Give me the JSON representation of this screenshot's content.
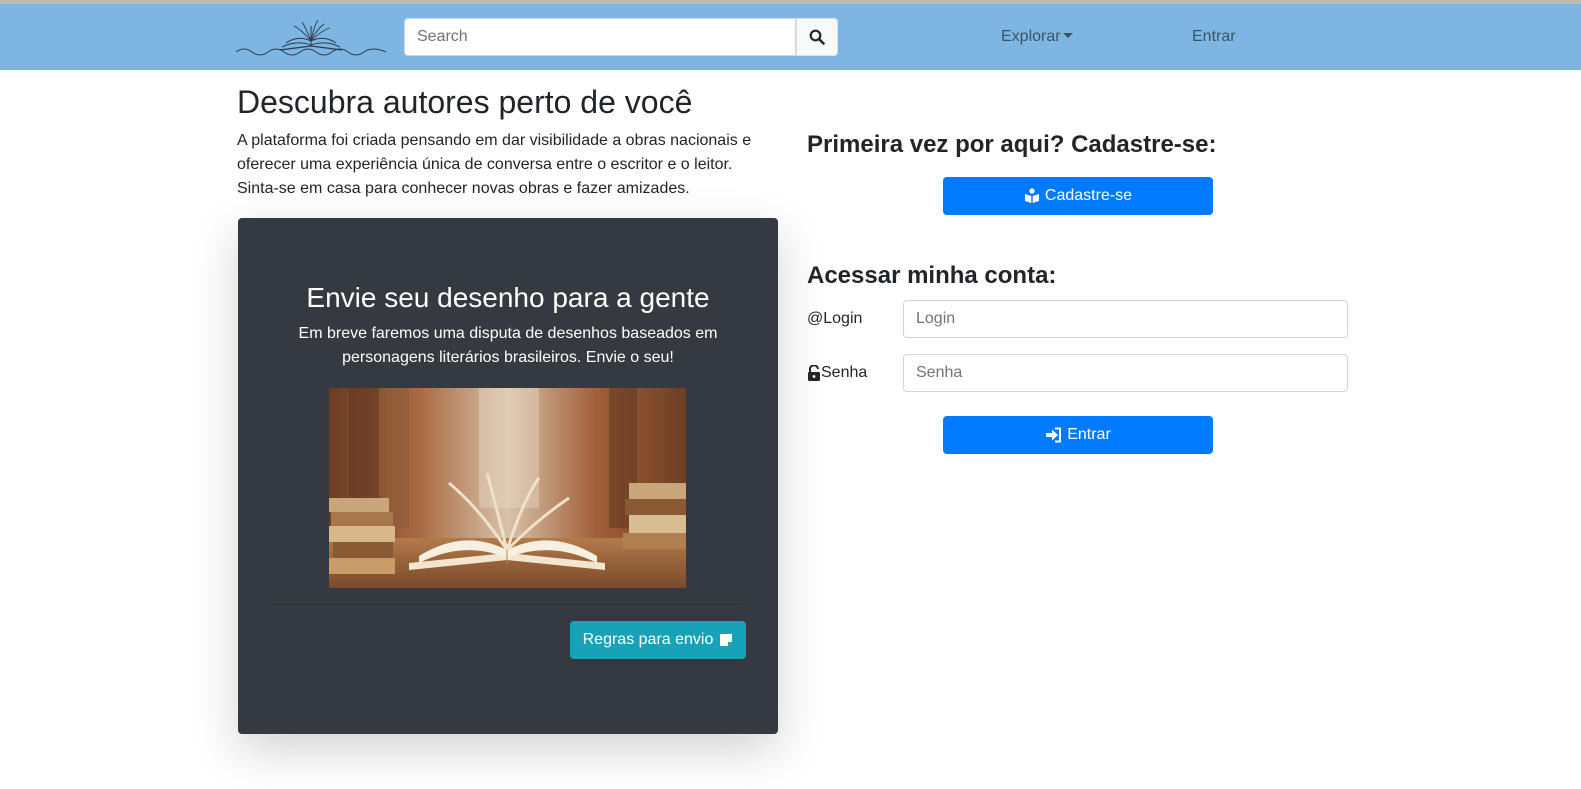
{
  "header": {
    "search": {
      "placeholder": "Search",
      "value": ""
    },
    "nav": {
      "explorar": "Explorar",
      "entrar": "Entrar"
    }
  },
  "hero": {
    "title": "Descubra autores perto de você",
    "text": "A plataforma foi criada pensando em dar visibilidade a obras nacionais e oferecer uma experiência única de conversa entre o escritor e o leitor. Sinta-se em casa para conhecer novas obras e fazer amizades."
  },
  "card": {
    "title": "Envie seu desenho para a gente",
    "text": "Em breve faremos uma disputa de desenhos baseados em personagens literários brasileiros. Envie o seu!",
    "button": "Regras para envio"
  },
  "signup": {
    "heading": "Primeira vez por aqui? Cadastre-se:",
    "button": "Cadastre-se"
  },
  "access": {
    "heading": "Acessar minha conta:",
    "login_label": "@Login",
    "login_placeholder": "Login",
    "senha_label": "Senha",
    "senha_placeholder": "Senha",
    "button": "Entrar"
  },
  "colors": {
    "navbar": "#7eb6e3",
    "primary": "#007bff",
    "info": "#17a2b8",
    "card_bg": "#343a40"
  },
  "icons": [
    "search-icon",
    "book-reader-icon",
    "unlock-icon",
    "sign-in-icon",
    "sticky-note-icon"
  ]
}
